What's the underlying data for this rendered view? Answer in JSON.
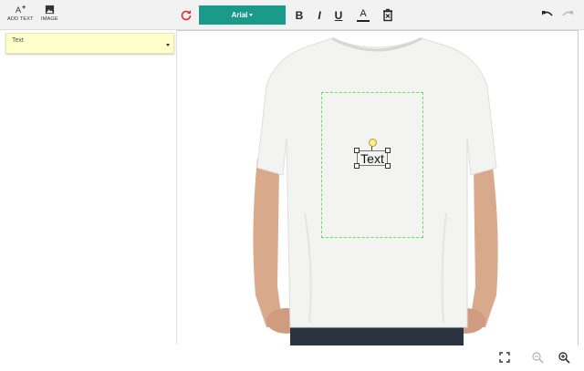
{
  "toolbar": {
    "add_text_label": "ADD TEXT",
    "image_label": "IMAGE",
    "font_name": "Arial",
    "bold_glyph": "B",
    "italic_glyph": "I",
    "underline_glyph": "U",
    "color_glyph": "A"
  },
  "editor": {
    "text_value": "Text",
    "canvas_text": "Text"
  },
  "colors": {
    "accent": "#1a9a88",
    "text_input_bg": "#ffffcc",
    "print_area_border": "#5ee35e",
    "refresh": "#e03131"
  },
  "icons": [
    "add-text-icon",
    "image-icon",
    "refresh-icon",
    "bold-icon",
    "italic-icon",
    "underline-icon",
    "text-color-icon",
    "delete-icon",
    "undo-icon",
    "redo-icon",
    "fullscreen-icon",
    "zoom-out-icon",
    "zoom-in-icon"
  ]
}
